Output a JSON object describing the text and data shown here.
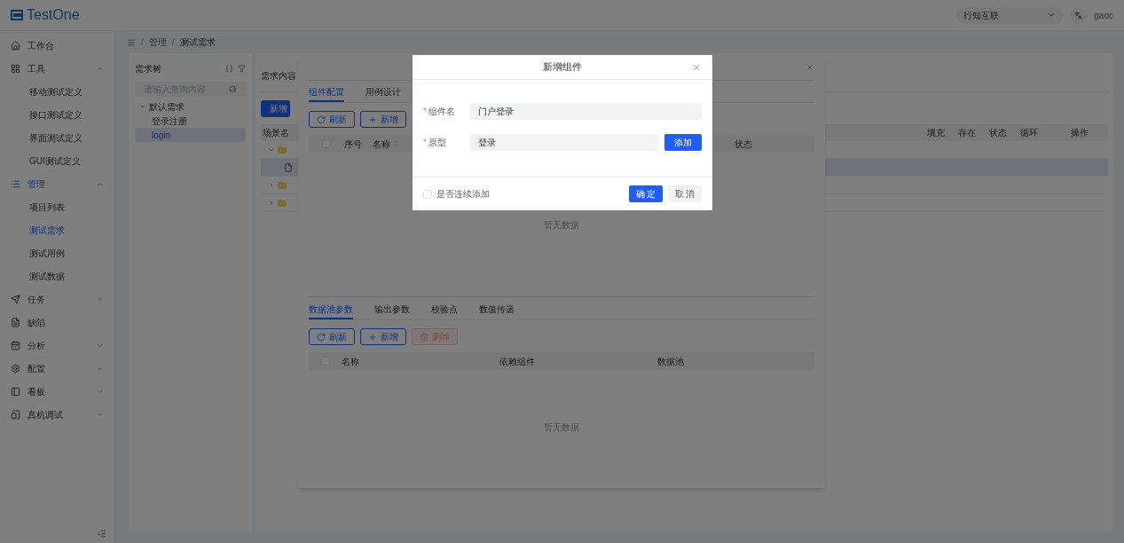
{
  "header": {
    "logo": "TestOne",
    "org_select": "行知互联",
    "user": "gaoc"
  },
  "sidebar": {
    "items": [
      {
        "label": "工作台",
        "active": false
      },
      {
        "label": "工具",
        "active": false,
        "expanded": true,
        "children": [
          {
            "label": "移动测试定义",
            "selected": false
          },
          {
            "label": "接口测试定义",
            "selected": false
          },
          {
            "label": "界面测试定义",
            "selected": false
          },
          {
            "label": "GUI测试定义",
            "selected": false
          }
        ]
      },
      {
        "label": "管理",
        "active": true,
        "expanded": true,
        "children": [
          {
            "label": "项目列表",
            "selected": false
          },
          {
            "label": "测试需求",
            "selected": true
          },
          {
            "label": "测试用例",
            "selected": false
          },
          {
            "label": "测试数据",
            "selected": false
          }
        ]
      },
      {
        "label": "任务",
        "active": false,
        "expanded": false
      },
      {
        "label": "缺陷",
        "active": false
      },
      {
        "label": "分析",
        "active": false,
        "expanded": false
      },
      {
        "label": "配置",
        "active": false,
        "expanded": false
      },
      {
        "label": "看板",
        "active": false,
        "expanded": false
      },
      {
        "label": "真机调试",
        "active": false,
        "expanded": false
      }
    ]
  },
  "breadcrumb": {
    "separator": "/",
    "items": [
      "管理",
      "测试需求"
    ]
  },
  "tree_panel": {
    "title": "需求树",
    "search": {
      "placeholder": "请输入查询内容"
    },
    "tree": [
      {
        "label": "默认需求",
        "expanded": true,
        "selected": false,
        "children": [
          {
            "label": "登录注册",
            "selected": false
          },
          {
            "label": "login",
            "selected": true
          }
        ]
      }
    ]
  },
  "content": {
    "title": "需求内容",
    "add_button": "新增",
    "columns": [
      "场景名",
      "填充",
      "存在",
      "状态",
      "循环",
      "操作"
    ],
    "rows": [
      {
        "kind": "folder",
        "expanded": true,
        "selected": false,
        "children": [
          {
            "kind": "file",
            "selected": true
          }
        ]
      },
      {
        "kind": "folder",
        "expanded": false,
        "selected": false
      },
      {
        "kind": "folder",
        "expanded": false,
        "selected": false
      }
    ]
  },
  "drawer": {
    "tabs": [
      {
        "label": "组件配置",
        "selected": true
      },
      {
        "label": "用例设计",
        "selected": false
      }
    ],
    "buttons": [
      {
        "kind": "refresh",
        "label": "刷新",
        "disabled": false
      },
      {
        "kind": "add",
        "label": "新增",
        "disabled": false
      }
    ],
    "select_all": {
      "checked": false
    },
    "columns": [
      "序号",
      "名称",
      "状态"
    ],
    "empty": "暂无数据",
    "sub_tabs": [
      {
        "label": "数据池参数",
        "selected": true
      },
      {
        "label": "输出参数",
        "selected": false
      },
      {
        "label": "校验点",
        "selected": false
      },
      {
        "label": "数值传递",
        "selected": false
      }
    ],
    "sub_buttons": [
      {
        "kind": "refresh",
        "label": "刷新",
        "disabled": false
      },
      {
        "kind": "add",
        "label": "新增",
        "disabled": false
      },
      {
        "kind": "delete",
        "label": "删除",
        "disabled": true
      }
    ],
    "sub_select_all": {
      "checked": false
    },
    "sub_columns": [
      "名称",
      "依赖组件",
      "数据池"
    ],
    "sub_empty": "暂无数据"
  },
  "modal": {
    "title": "新增组件",
    "fields": [
      {
        "label": "组件名",
        "required_mark": "*",
        "value": "门户登录"
      },
      {
        "label": "原型",
        "required_mark": "*",
        "value": "登录",
        "action": "添加"
      }
    ],
    "continuous": {
      "label": "是否连续添加",
      "checked": false
    },
    "buttons": [
      {
        "kind": "primary",
        "label": "确 定"
      },
      {
        "kind": "default",
        "label": "取 消"
      }
    ]
  }
}
